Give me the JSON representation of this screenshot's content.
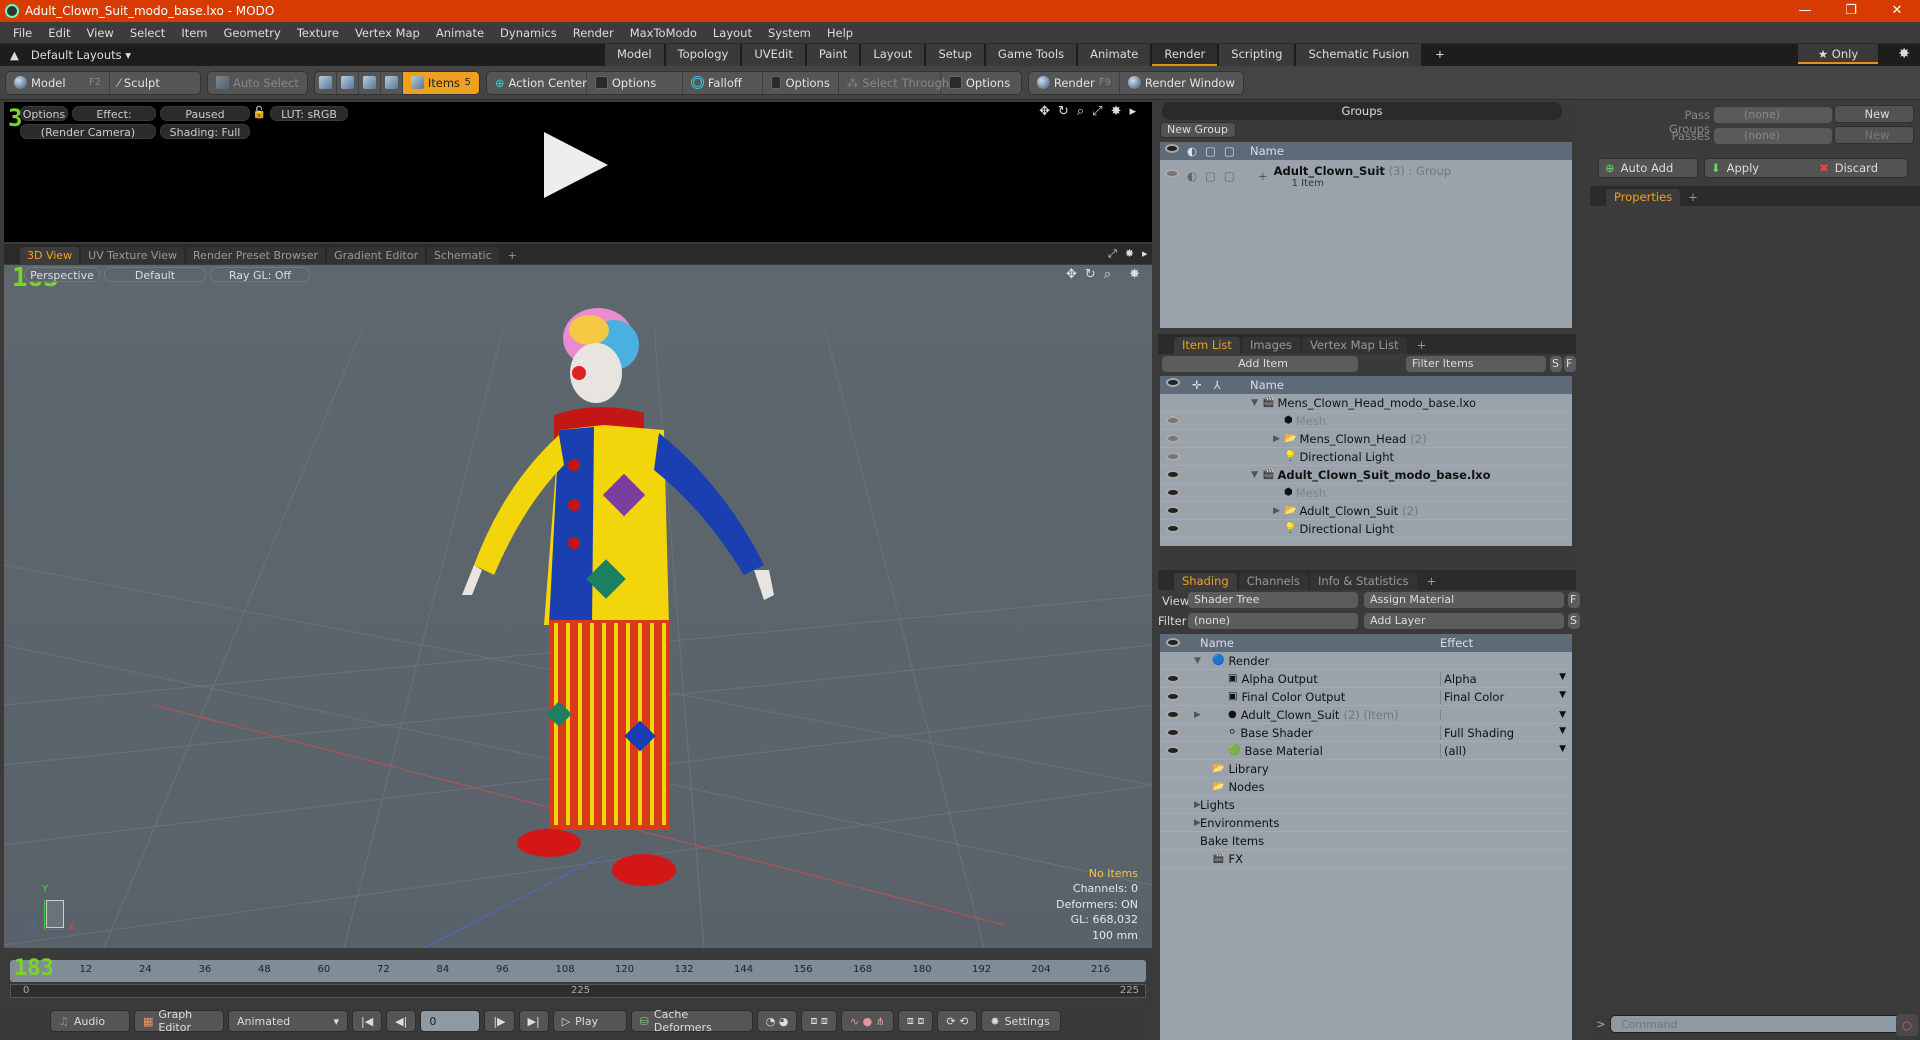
{
  "window": {
    "title": "Adult_Clown_Suit_modo_base.lxo - MODO",
    "controls": [
      "—",
      "❐",
      "✕"
    ]
  },
  "menu": [
    "File",
    "Edit",
    "View",
    "Select",
    "Item",
    "Geometry",
    "Texture",
    "Vertex Map",
    "Animate",
    "Dynamics",
    "Render",
    "MaxToModo",
    "Layout",
    "System",
    "Help"
  ],
  "layoutbar": {
    "layouts_label": "Default Layouts ▾",
    "tabs": [
      "Model",
      "Topology",
      "UVEdit",
      "Paint",
      "Layout",
      "Setup",
      "Game Tools",
      "Animate",
      "Render",
      "Scripting",
      "Schematic Fusion"
    ],
    "active_tab": "Render",
    "add": "+",
    "only_label": "★  Only"
  },
  "toolbar": {
    "model": "Model",
    "model_key": "F2",
    "sculpt": "Sculpt",
    "auto_select": "Auto Select",
    "items": "Items",
    "items_count": "5",
    "action_center": "Action Center",
    "options1": "Options",
    "falloff": "Falloff",
    "options2": "Options",
    "select_through": "Select Through",
    "options3": "Options",
    "render": "Render",
    "render_key": "F9",
    "render_window": "Render Window"
  },
  "preview": {
    "options": "Options",
    "effect": "Effect: (Shadi...",
    "paused": "Paused",
    "lut": "LUT: sRGB",
    "camera": "(Render Camera)",
    "shading": "Shading: Full",
    "counter": "3"
  },
  "viewtabs": {
    "tabs": [
      "3D View",
      "UV Texture View",
      "Render Preset Browser",
      "Gradient Editor",
      "Schematic"
    ],
    "add": "+"
  },
  "viewport": {
    "perspective": "Perspective",
    "default": "Default",
    "raygl": "Ray GL: Off",
    "fps": "183",
    "stats": {
      "no_items": "No Items",
      "channels": "Channels: 0",
      "deformers": "Deformers: ON",
      "gl": "GL: 668,032",
      "scale": "100 mm"
    },
    "axis": {
      "x": "X",
      "y": "Y",
      "z": "Z"
    }
  },
  "groups": {
    "title": "Groups",
    "new_group": "New Group",
    "col_name": "Name",
    "rows": [
      {
        "name": "Adult_Clown_Suit",
        "count": "(3)",
        "type": ": Group",
        "sub": "1 Item"
      }
    ]
  },
  "passes": {
    "pass_groups_label": "Pass Groups",
    "pass_groups_value": "(none)",
    "passes_label": "Passes",
    "passes_value": "(none)",
    "new": "New",
    "auto_add": "Auto Add",
    "apply": "Apply",
    "discard": "Discard"
  },
  "properties": {
    "tab": "Properties",
    "add": "+"
  },
  "itemlist": {
    "tabs": [
      "Item List",
      "Images",
      "Vertex Map List"
    ],
    "add": "+",
    "add_item": "Add Item",
    "filter": "Filter Items",
    "s": "S",
    "f": "F",
    "col_name": "Name",
    "rows": [
      {
        "name": "Mens_Clown_Head_modo_base.lxo",
        "count": "",
        "indent": 0,
        "bold": false,
        "dim": false,
        "arrow": "▼",
        "eye": false
      },
      {
        "name": "Mesh",
        "count": "",
        "indent": 1,
        "bold": false,
        "dim": true,
        "arrow": "",
        "eye": "dim"
      },
      {
        "name": "Mens_Clown_Head",
        "count": "(2)",
        "indent": 1,
        "bold": false,
        "dim": false,
        "arrow": "▶",
        "eye": "dim"
      },
      {
        "name": "Directional Light",
        "count": "",
        "indent": 1,
        "bold": false,
        "dim": false,
        "arrow": "",
        "eye": "dim"
      },
      {
        "name": "Adult_Clown_Suit_modo_base.lxo",
        "count": "",
        "indent": 0,
        "bold": true,
        "dim": false,
        "arrow": "▼",
        "eye": "on"
      },
      {
        "name": "Mesh",
        "count": "",
        "indent": 1,
        "bold": false,
        "dim": true,
        "arrow": "",
        "eye": "on"
      },
      {
        "name": "Adult_Clown_Suit",
        "count": "(2)",
        "indent": 1,
        "bold": false,
        "dim": false,
        "arrow": "▶",
        "eye": "on"
      },
      {
        "name": "Directional Light",
        "count": "",
        "indent": 1,
        "bold": false,
        "dim": false,
        "arrow": "",
        "eye": "on"
      }
    ]
  },
  "shading": {
    "tabs": [
      "Shading",
      "Channels",
      "Info & Statistics"
    ],
    "add": "+",
    "view_label": "View",
    "view_value": "Shader Tree",
    "assign_material": "Assign Material",
    "f": "F",
    "filter_label": "Filter",
    "filter_value": "(none)",
    "add_layer": "Add Layer",
    "s": "S",
    "col_name": "Name",
    "col_effect": "Effect",
    "rows": [
      {
        "name": "Render",
        "extra": "",
        "effect": "",
        "indent": 0,
        "eye": false,
        "arrow": "▼"
      },
      {
        "name": "Alpha Output",
        "extra": "",
        "effect": "Alpha",
        "indent": 1,
        "eye": true,
        "arrow": ""
      },
      {
        "name": "Final Color Output",
        "extra": "",
        "effect": "Final Color",
        "indent": 1,
        "eye": true,
        "arrow": ""
      },
      {
        "name": "Adult_Clown_Suit",
        "extra": "(2) (Item)",
        "effect": "",
        "indent": 1,
        "eye": true,
        "arrow": "▶"
      },
      {
        "name": "Base Shader",
        "extra": "",
        "effect": "Full Shading",
        "indent": 1,
        "eye": true,
        "arrow": ""
      },
      {
        "name": "Base Material",
        "extra": "",
        "effect": "(all)",
        "indent": 1,
        "eye": true,
        "arrow": ""
      },
      {
        "name": "Library",
        "extra": "",
        "effect": "",
        "indent": 0,
        "eye": false,
        "arrow": ""
      },
      {
        "name": "Nodes",
        "extra": "",
        "effect": "",
        "indent": 0,
        "eye": false,
        "arrow": ""
      },
      {
        "name": "Lights",
        "extra": "",
        "effect": "",
        "indent": -1,
        "eye": false,
        "arrow": "▶"
      },
      {
        "name": "Environments",
        "extra": "",
        "effect": "",
        "indent": -1,
        "eye": false,
        "arrow": "▶"
      },
      {
        "name": "Bake Items",
        "extra": "",
        "effect": "",
        "indent": -1,
        "eye": false,
        "arrow": ""
      },
      {
        "name": "FX",
        "extra": "",
        "effect": "",
        "indent": 0,
        "eye": false,
        "arrow": ""
      }
    ]
  },
  "timeline": {
    "ticks": [
      "0",
      "12",
      "24",
      "36",
      "48",
      "60",
      "72",
      "84",
      "96",
      "108",
      "120",
      "132",
      "144",
      "156",
      "168",
      "180",
      "192",
      "204",
      "216"
    ],
    "range_start": "0",
    "range_mid": "225",
    "range_end": "225"
  },
  "bottombar": {
    "audio": "Audio",
    "graph_editor": "Graph Editor",
    "animated": "Animated",
    "frame": "0",
    "play": "Play",
    "cache_deformers": "Cache Deformers",
    "settings": "Settings"
  },
  "command": {
    "prompt": ">",
    "placeholder": "Command"
  }
}
